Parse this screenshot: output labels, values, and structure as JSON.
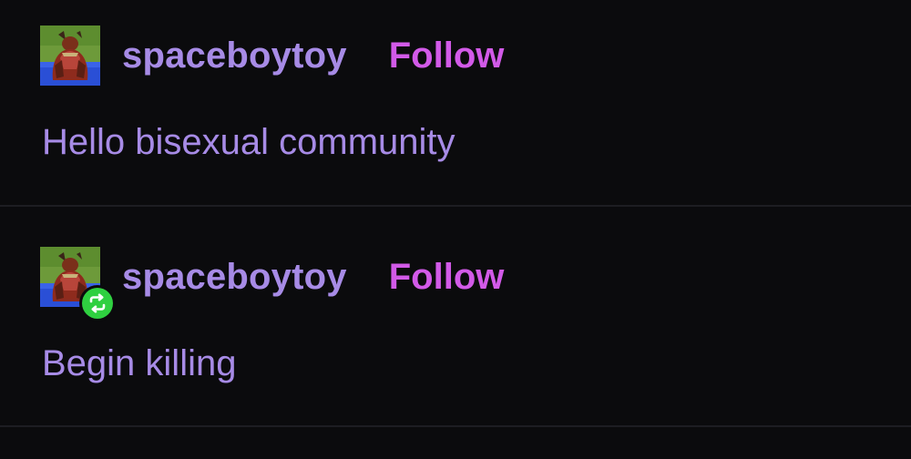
{
  "posts": [
    {
      "username": "spaceboytoy",
      "follow_label": "Follow",
      "body": "Hello bisexual community",
      "reblog": false
    },
    {
      "username": "spaceboytoy",
      "follow_label": "Follow",
      "body": "Begin killing",
      "reblog": true
    }
  ],
  "colors": {
    "background": "#0b0b0d",
    "text": "#a78be6",
    "follow": "#d25ae8",
    "reblog_badge": "#2fd040"
  },
  "icons": {
    "avatar": "avatar-icon",
    "reblog": "reblog-icon"
  }
}
